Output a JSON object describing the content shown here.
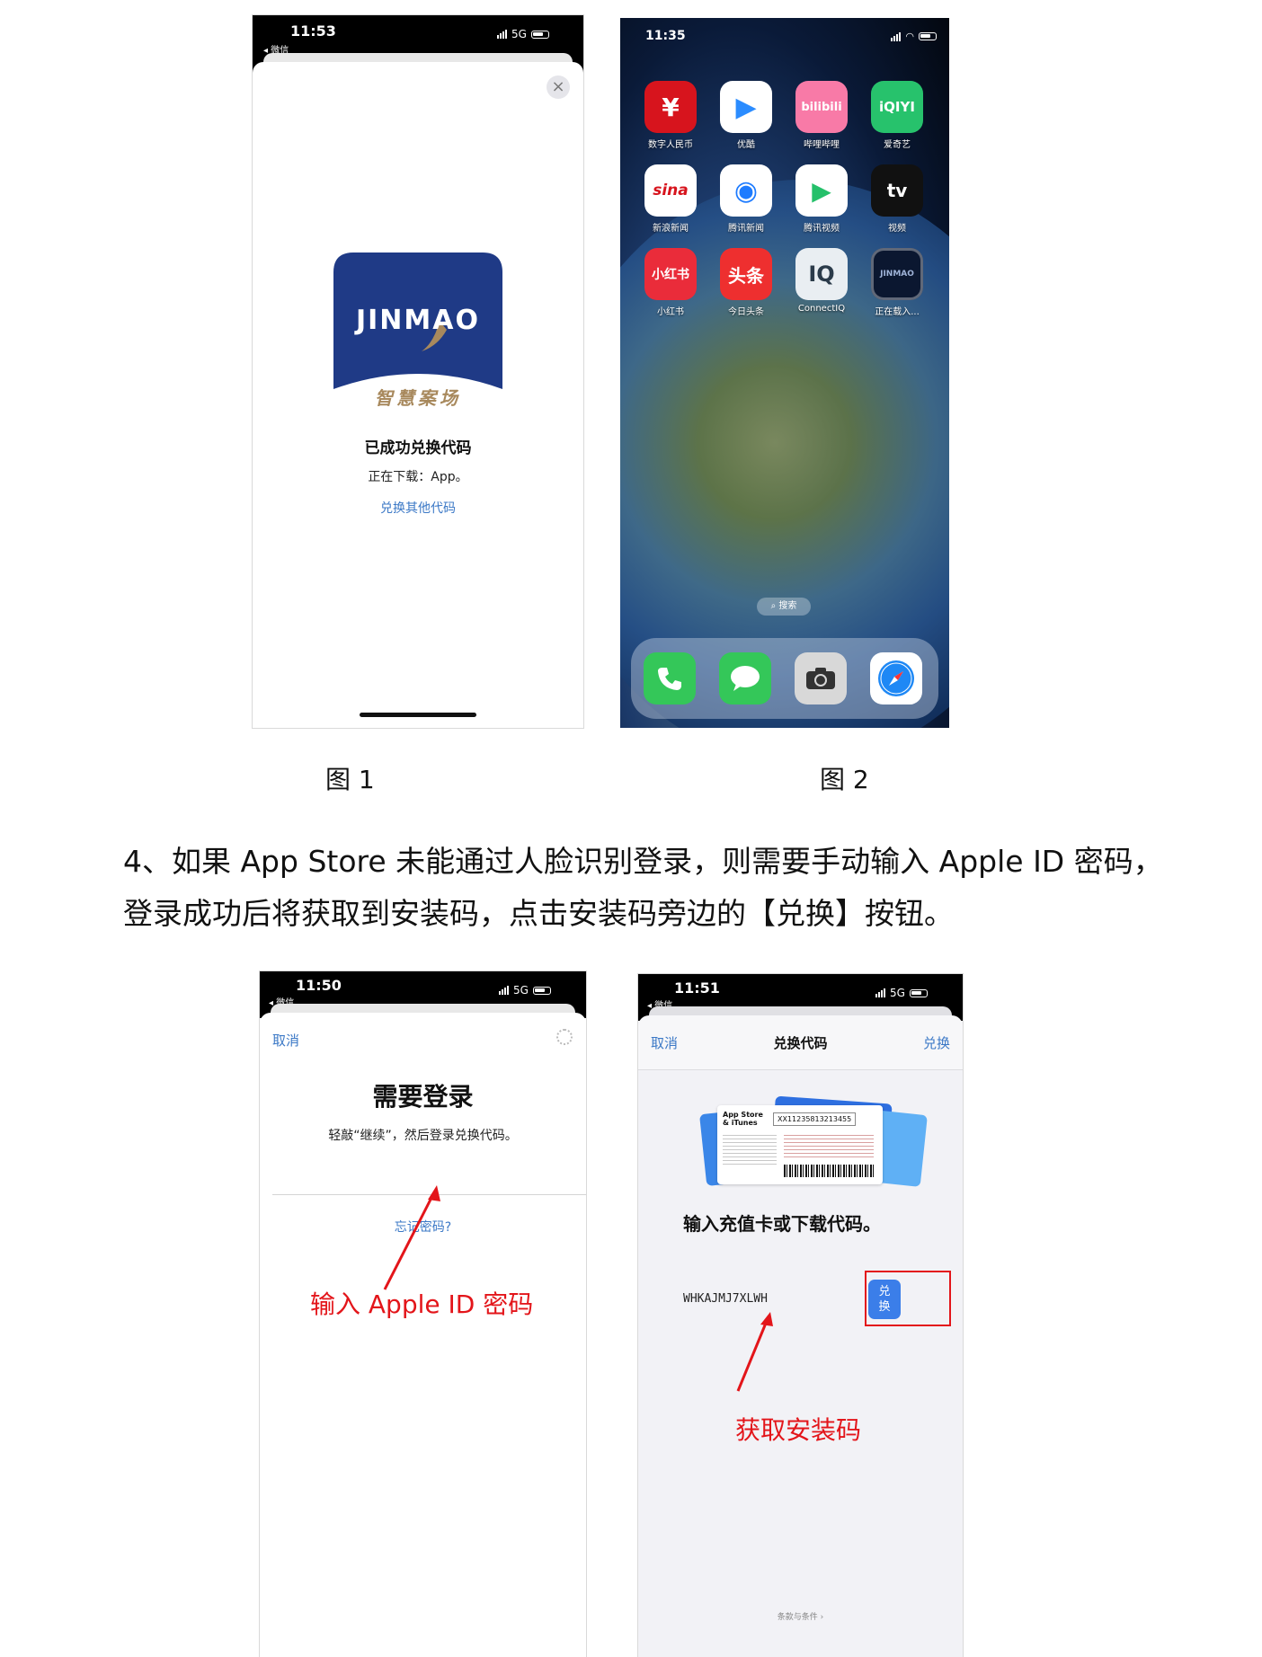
{
  "figure1": {
    "status_time": "11:53",
    "status_back": "◂ 微信",
    "status_network": "5G",
    "logo_text": "JINMAO",
    "logo_subtitle": "智慧案场",
    "success_title": "已成功兑换代码",
    "downloading_text": "正在下载：App。",
    "redeem_other_link": "兑换其他代码",
    "close_symbol": "×"
  },
  "figure2": {
    "status_time": "11:35",
    "apps": [
      {
        "label": "数字人民币",
        "glyph": "¥",
        "bg": "#d7141d"
      },
      {
        "label": "优酷",
        "glyph": "▶",
        "bg": "#ffffff"
      },
      {
        "label": "哔哩哔哩",
        "glyph": "bilibili",
        "bg": "#f87aa7"
      },
      {
        "label": "爱奇艺",
        "glyph": "iQIYI",
        "bg": "#27c26c"
      },
      {
        "label": "新浪新闻",
        "glyph": "sina",
        "bg": "#ffffff"
      },
      {
        "label": "腾讯新闻",
        "glyph": "◉",
        "bg": "#ffffff"
      },
      {
        "label": "腾讯视频",
        "glyph": "▶",
        "bg": "#ffffff"
      },
      {
        "label": "视频",
        "glyph": "tv",
        "bg": "#111111"
      },
      {
        "label": "小红书",
        "glyph": "小红书",
        "bg": "#ea2c3a"
      },
      {
        "label": "今日头条",
        "glyph": "头条",
        "bg": "#ee2f2f"
      },
      {
        "label": "ConnectIQ",
        "glyph": "IQ",
        "bg": "#e9eef2"
      },
      {
        "label": "正在载入...",
        "glyph": "JINMAO",
        "bg": "#0b1730"
      }
    ],
    "search_pill": "⌕ 搜索"
  },
  "captions": {
    "fig1": "图 1",
    "fig2": "图 2"
  },
  "step4": {
    "line1": "4、如果 App Store 未能通过人脸识别登录，则需要手动输入 Apple ID 密码，",
    "line2": "登录成功后将获取到安装码，点击安装码旁边的【兑换】按钮。"
  },
  "figure3": {
    "status_time": "11:50",
    "status_back": "◂ 微信",
    "status_network": "5G",
    "cancel": "取消",
    "title": "需要登录",
    "subtitle": "轻敲“继续”，然后登录兑换代码。",
    "forgot_password": "忘记密码?",
    "annotation": "输入 Apple ID 密码"
  },
  "figure4": {
    "status_time": "11:51",
    "status_back": "◂ 微信",
    "status_network": "5G",
    "cancel": "取消",
    "nav_title": "兑换代码",
    "redeem": "兑换",
    "card_brand": "App Store & iTunes",
    "card_code": "XX11235813213455",
    "prompt": "输入充值卡或下载代码。",
    "code": "WHKAJMJ7XLWH",
    "redeem_button": "兑换",
    "terms": "条款与条件 ›",
    "annotation": "获取安装码"
  },
  "colors": {
    "annotation_red": "#e3151a",
    "ios_blue": "#3b78c6",
    "jinmao_navy": "#1f3a86",
    "jinmao_gold": "#a8895d"
  }
}
